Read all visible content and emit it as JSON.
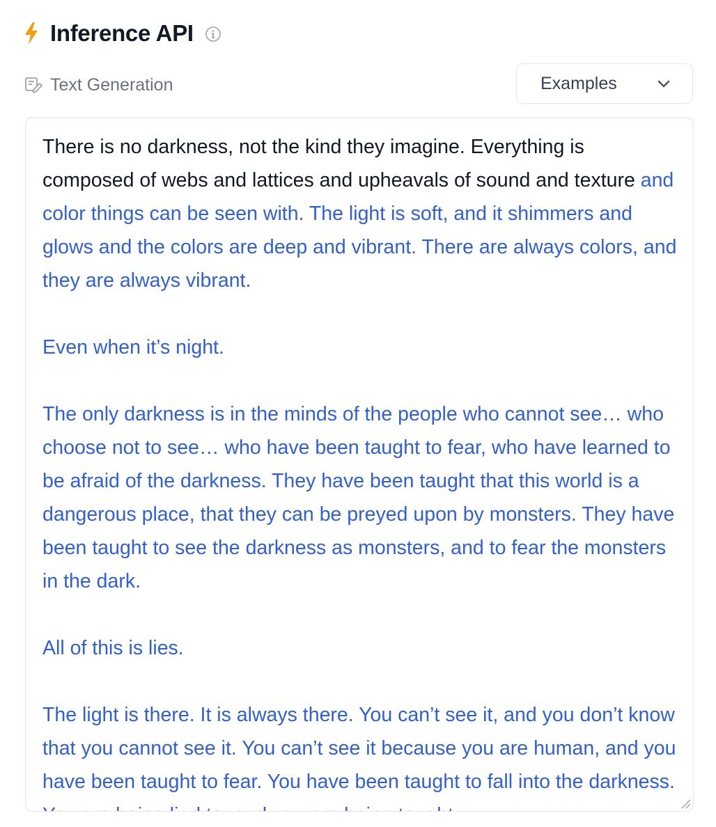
{
  "header": {
    "title": "Inference API",
    "icon": "lightning-bolt-icon",
    "info_icon": "info-icon",
    "accent_color": "#f59e0b"
  },
  "task": {
    "icon": "text-generation-icon",
    "label": "Text Generation"
  },
  "examples_dropdown": {
    "label": "Examples",
    "icon": "chevron-down-icon"
  },
  "editor": {
    "prompt_text": "There is no darkness, not the kind they imagine. Everything is composed of webs and lattices and upheavals of sound and texture",
    "generated_text": " and color things can be seen with. The light is soft, and it shimmers and glows and the colors are deep and vibrant. There are always colors, and they are always vibrant.\n\nEven when it’s night.\n\nThe only darkness is in the minds of the people who cannot see… who choose not to see… who have been taught to fear, who have learned to be afraid of the darkness. They have been taught that this world is a dangerous place, that they can be preyed upon by monsters. They have been taught to see the darkness as monsters, and to fear the monsters in the dark.\n\nAll of this is lies.\n\nThe light is there. It is always there. You can’t see it, and you don’t know that you cannot see it. You can’t see it because you are human, and you have been taught to fear. You have been taught to fall into the darkness. You are being lied to, and you are being taught",
    "generated_color": "#2f5fe0",
    "prompt_color": "#111827"
  }
}
